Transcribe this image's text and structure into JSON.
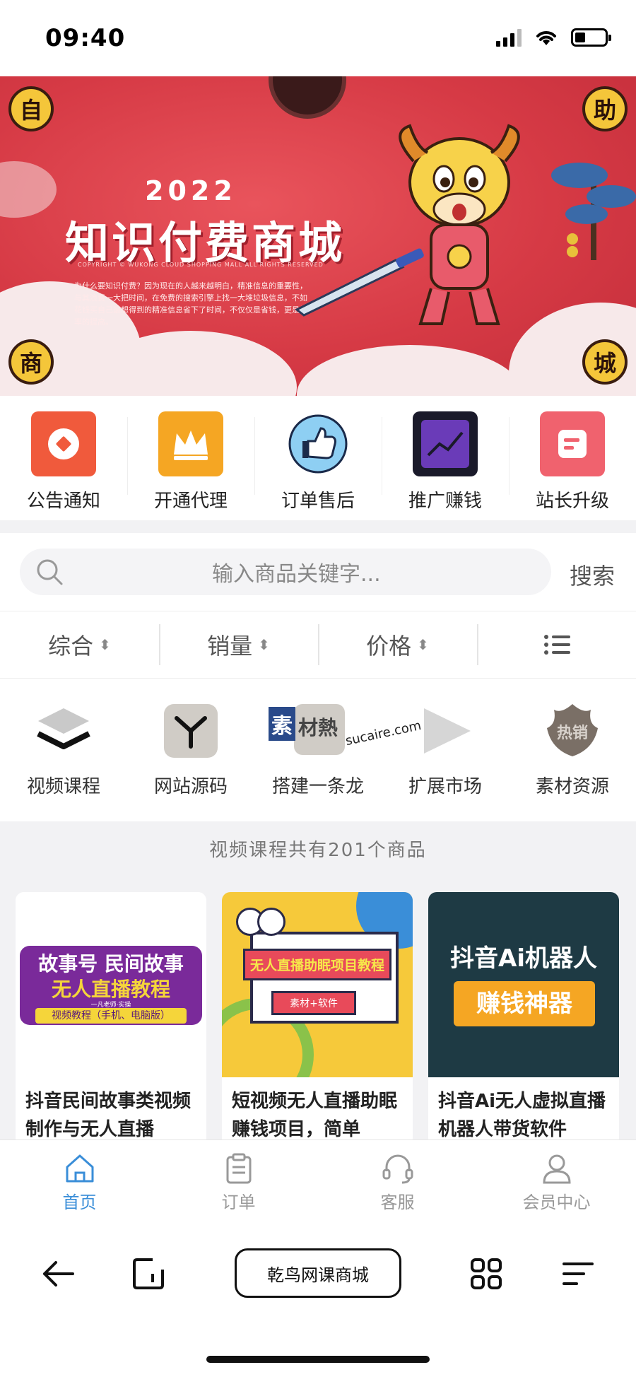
{
  "status_bar": {
    "time": "09:40"
  },
  "banner": {
    "year": "2022",
    "title": "知识付费商城",
    "copyright": "COPYRIGHT © WUKONG CLOUD SHOPPING MALL ALL RIGHTS RESERVED",
    "description": "为什么要知识付费？因为现在的人越来越明白，精准信息的重要性，与其浪费一大把时间，在免费的搜索引擎上找一大堆垃圾信息，不如花钱买自己最想得到的精准信息省下了时间，不仅仅是省钱，更是效率的提高。",
    "corner_badges": [
      "自",
      "助",
      "商",
      "城"
    ]
  },
  "quick_menu": {
    "items": [
      {
        "label": "公告通知",
        "icon": "announcement-icon",
        "color": "#f05a3c"
      },
      {
        "label": "开通代理",
        "icon": "crown-icon",
        "color": "#f5a623"
      },
      {
        "label": "订单售后",
        "icon": "thumbs-up-icon",
        "color": "#7fc3ee"
      },
      {
        "label": "推广赚钱",
        "icon": "chart-icon",
        "color": "#6a3bb8"
      },
      {
        "label": "站长升级",
        "icon": "upgrade-icon",
        "color": "#f0626e"
      }
    ]
  },
  "search": {
    "placeholder": "输入商品关键字...",
    "button_label": "搜索"
  },
  "sort_bar": {
    "items": [
      {
        "label": "综合",
        "arrow": "⬍"
      },
      {
        "label": "销量",
        "arrow": "⬍"
      },
      {
        "label": "价格",
        "arrow": "⬍"
      }
    ],
    "view_toggle_icon": "list-view-icon"
  },
  "categories": {
    "items": [
      {
        "label": "视频课程",
        "icon": "layers-icon"
      },
      {
        "label": "网站源码",
        "icon": "code-icon"
      },
      {
        "label": "搭建一条龙",
        "icon": "build-icon"
      },
      {
        "label": "扩展市场",
        "icon": "play-icon"
      },
      {
        "label": "素材资源",
        "icon": "hot-sale-icon"
      }
    ],
    "watermark": {
      "logo": "素",
      "text": "材熱",
      "url": "sucaire.com"
    }
  },
  "product_count_caption": "视频课程共有201个商品",
  "products": [
    {
      "title": "抖音民间故事类视频制作与无人直播",
      "thumb_lines": [
        "故事号 民间故事",
        "无人直播教程",
        "一凡老师·实操",
        "视频教程（手机、电脑版）"
      ]
    },
    {
      "title": "短视频无人直播助眠赚钱项目，简单",
      "thumb_lines": [
        "无人直播助眠项目教程",
        "素材+软件"
      ]
    },
    {
      "title": "抖音Ai无人虚拟直播机器人带货软件",
      "thumb_lines": [
        "抖音Ai机器人",
        "赚钱神器"
      ]
    }
  ],
  "tabbar": {
    "items": [
      {
        "label": "首页",
        "icon": "home-icon",
        "active": true
      },
      {
        "label": "订单",
        "icon": "clipboard-icon",
        "active": false
      },
      {
        "label": "客服",
        "icon": "headset-icon",
        "active": false
      },
      {
        "label": "会员中心",
        "icon": "user-icon",
        "active": false
      }
    ]
  },
  "browser_bar": {
    "title": "乾鸟网课商城"
  }
}
